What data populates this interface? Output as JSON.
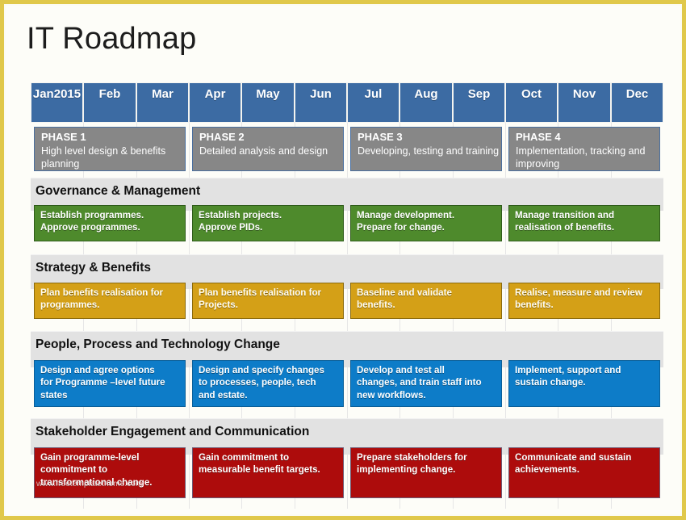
{
  "slide": {
    "title": "IT Roadmap",
    "frame_color": "#e0c84a",
    "background": "#fdfdf8",
    "watermark": "www.freetemplatetheme.com"
  },
  "timeline": {
    "months": [
      {
        "label": "Jan",
        "year": "2015"
      },
      {
        "label": "Feb",
        "year": ""
      },
      {
        "label": "Mar",
        "year": ""
      },
      {
        "label": "Apr",
        "year": ""
      },
      {
        "label": "May",
        "year": ""
      },
      {
        "label": "Jun",
        "year": ""
      },
      {
        "label": "Jul",
        "year": ""
      },
      {
        "label": "Aug",
        "year": ""
      },
      {
        "label": "Sep",
        "year": ""
      },
      {
        "label": "Oct",
        "year": ""
      },
      {
        "label": "Nov",
        "year": ""
      },
      {
        "label": "Dec",
        "year": ""
      }
    ],
    "header_color": "#3c6ba3"
  },
  "phases": [
    {
      "name": "PHASE 1",
      "desc": "High level design & benefits planning"
    },
    {
      "name": "PHASE 2",
      "desc": "Detailed analysis and design"
    },
    {
      "name": "PHASE 3",
      "desc": "Developing, testing and training"
    },
    {
      "name": "PHASE 4",
      "desc": "Implementation, tracking and improving"
    }
  ],
  "phase_color": "#878787",
  "lanes": [
    {
      "title": "Governance & Management",
      "color": "#4e8a2c",
      "tasks": [
        "Establish programmes. Approve programmes.",
        "Establish projects. Approve PIDs.",
        "Manage development. Prepare for change.",
        "Manage transition and realisation of benefits."
      ],
      "task_lines": [
        [
          "Establish  programmes.",
          "Approve  programmes."
        ],
        [
          "Establish  projects.",
          "Approve  PIDs."
        ],
        [
          "Manage  development.",
          "Prepare for change."
        ],
        [
          "Manage  transition and",
          "realisation  of benefits."
        ]
      ]
    },
    {
      "title": "Strategy & Benefits",
      "color": "#d4a017",
      "tasks": [
        "Plan benefits realisation for programmes.",
        "Plan benefits realisation for Projects.",
        "Baseline and validate benefits.",
        "Realise, measure and review benefits."
      ],
      "task_lines": [
        [
          "Plan benefits  realisation  for",
          "programmes."
        ],
        [
          "Plan benefits  realisation  for",
          "Projects."
        ],
        [
          "Baseline  and validate",
          "benefits."
        ],
        [
          "Realise, measure  and review",
          "benefits."
        ]
      ]
    },
    {
      "title": "People, Process and Technology Change",
      "color": "#0d7cc8",
      "tasks": [
        "Design and agree options for Programme –level future states",
        "Design and specify changes to processes, people, tech and estate.",
        "Develop and test all changes, and train staff into new workflows.",
        "Implement, support and sustain change."
      ],
      "task_lines": [
        [
          "Design and agree options",
          "for Programme –level future",
          "states"
        ],
        [
          "Design and specify changes",
          "to processes, people, tech",
          "and estate."
        ],
        [
          "Develop and test all",
          "changes, and train staff into",
          "new workflows."
        ],
        [
          "Implement,  support and",
          "sustain change."
        ]
      ]
    },
    {
      "title": "Stakeholder Engagement and Communication",
      "color": "#ad0c0c",
      "tasks": [
        "Gain programme-level commitment to transformational change.",
        "Gain commitment to measurable benefit targets.",
        "Prepare stakeholders for implementing change.",
        "Communicate and sustain achievements."
      ],
      "task_lines": [
        [
          "Gain programme-level",
          "commitment  to",
          "transformational  change."
        ],
        [
          "Gain commitment  to",
          "measurable  benefit targets."
        ],
        [
          "Prepare stakeholders  for",
          "implementing  change."
        ],
        [
          "Communicate  and sustain",
          "achievements."
        ]
      ]
    }
  ]
}
